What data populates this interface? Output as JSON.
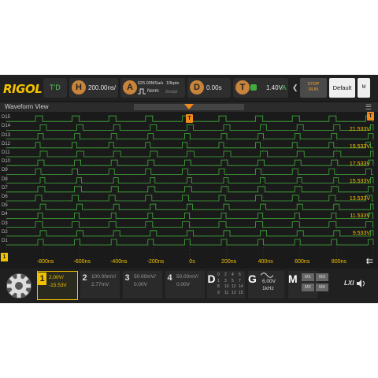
{
  "brand": "RIGOL",
  "trigger_status": "T'D",
  "horizontal": {
    "letter": "H",
    "timebase": "200.00ns/"
  },
  "acquire": {
    "letter": "A",
    "sample_rate": "625.00MSa/s",
    "memory_depth": "10kpts",
    "mode": "Norm",
    "resolution": "2ns/pt"
  },
  "delay": {
    "letter": "D",
    "value": "0.00s"
  },
  "trigger": {
    "letter": "T",
    "level": "1.40V",
    "source": "A"
  },
  "controls": {
    "stop_run": [
      "STOP",
      "RUN"
    ],
    "default": "Default",
    "more": "M"
  },
  "waveform_view": {
    "title": "Waveform View",
    "trigger_marker": "T",
    "digital_channels": [
      "D15",
      "D14",
      "D13",
      "D12",
      "D11",
      "D10",
      "D9",
      "D8",
      "D7",
      "D6",
      "D5",
      "D4",
      "D3",
      "D2",
      "D1"
    ],
    "threshold_labels": [
      "21.533V",
      "19.533V",
      "17.533V",
      "15.533V",
      "13.533V",
      "11.533V",
      "9.533V"
    ],
    "time_labels": [
      "-800ns",
      "-600ns",
      "-400ns",
      "-200ns",
      "0s",
      "200ns",
      "400ns",
      "600ns",
      "800ns"
    ],
    "ground_marker": "1",
    "colors": {
      "trace": "#3fae3a",
      "label": "#f2c200",
      "grid": "#4a4a4a",
      "marker": "#f08a1c"
    }
  },
  "channels": [
    {
      "num": "1",
      "scale": "2.00V/",
      "offset": "-15.53V",
      "active": true,
      "color": "#f2c200"
    },
    {
      "num": "2",
      "scale": "100.00mV/",
      "offset": "2.77mV",
      "active": false,
      "color": "#9a9a9a"
    },
    {
      "num": "3",
      "scale": "50.00mV/",
      "offset": "0.00V",
      "active": false,
      "color": "#9a9a9a"
    },
    {
      "num": "4",
      "scale": "50.00mV/",
      "offset": "0.00V",
      "active": false,
      "color": "#9a9a9a"
    }
  ],
  "digital": {
    "letter": "D",
    "bits": [
      "0",
      "1",
      "2",
      "3",
      "4",
      "5",
      "6",
      "7",
      "8",
      "9",
      "10",
      "11",
      "12",
      "13",
      "14",
      "15"
    ]
  },
  "generator": {
    "letter": "G",
    "voltage": "6.00V",
    "frequency": "1kHz"
  },
  "math": {
    "letter": "M",
    "items": [
      "M1",
      "M2",
      "M3",
      "M4"
    ]
  },
  "lxi": "LXI"
}
